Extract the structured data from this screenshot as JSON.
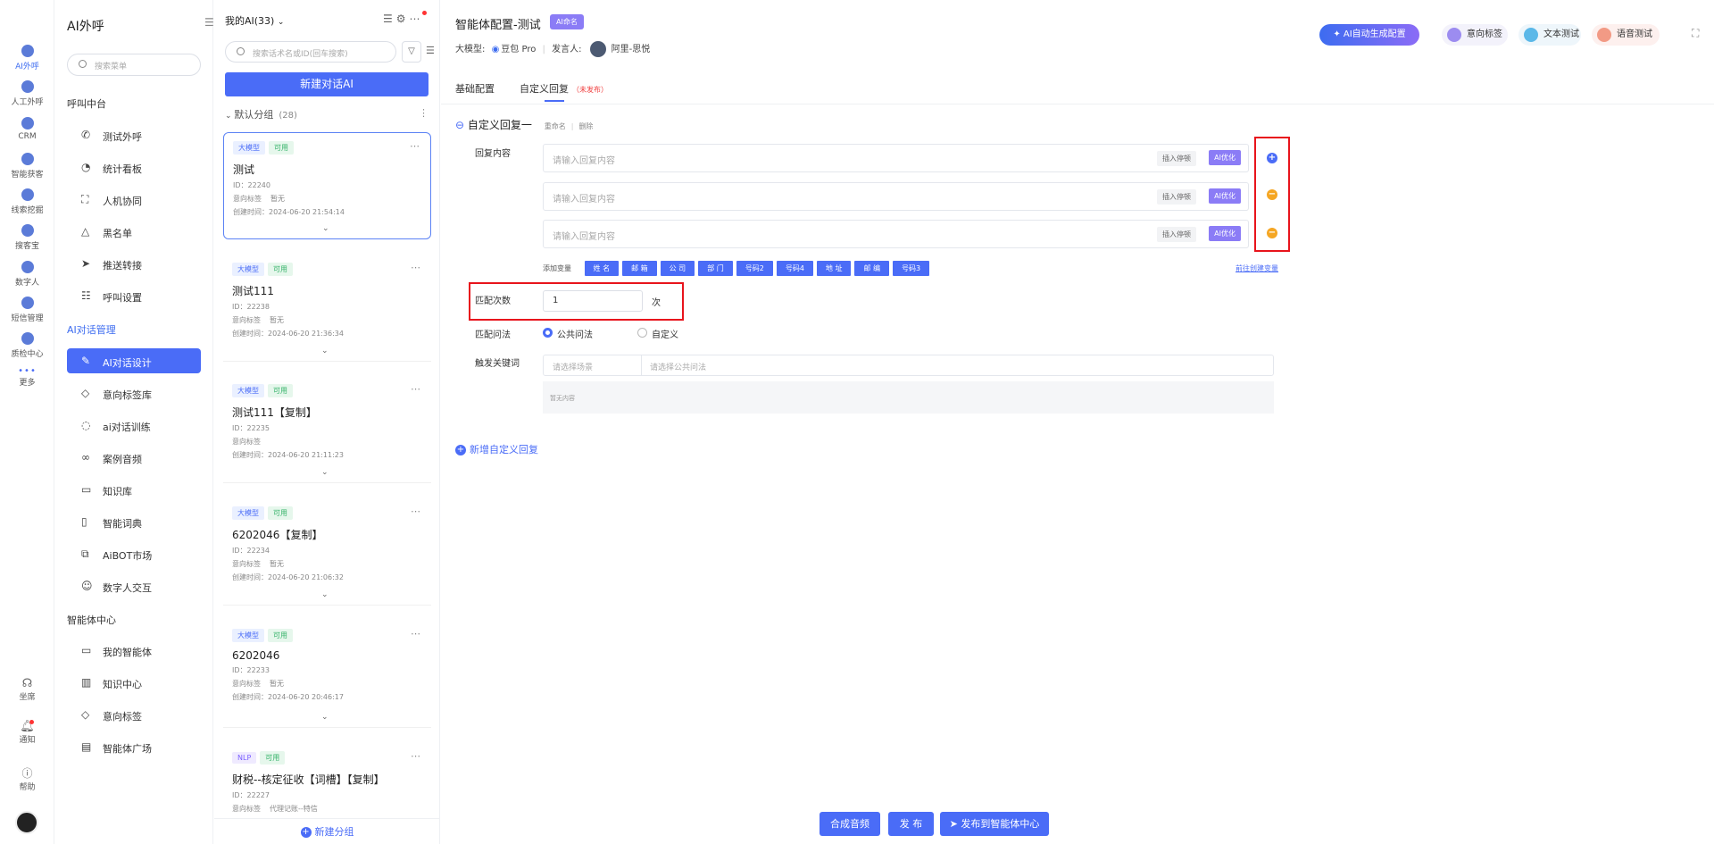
{
  "rail": {
    "items": [
      {
        "label": "AI外呼",
        "icon": "phone-ai-icon"
      },
      {
        "label": "人工外呼",
        "icon": "headset-icon"
      },
      {
        "label": "CRM",
        "icon": "crm-icon"
      },
      {
        "label": "智能获客",
        "icon": "customer-icon"
      },
      {
        "label": "线索挖掘",
        "icon": "clue-icon"
      },
      {
        "label": "搜客宝",
        "icon": "search-customer-icon"
      },
      {
        "label": "数字人",
        "icon": "digital-human-icon"
      },
      {
        "label": "短信管理",
        "icon": "sms-icon"
      },
      {
        "label": "质检中心",
        "icon": "inspection-icon"
      },
      {
        "label": "更多",
        "icon": "more-dots-icon"
      }
    ],
    "bottom": [
      {
        "label": "坐席",
        "icon": "seat-icon"
      },
      {
        "label": "通知",
        "icon": "bell-icon"
      },
      {
        "label": "帮助",
        "icon": "help-icon"
      }
    ]
  },
  "nav": {
    "title": "AI外呼",
    "search_placeholder": "搜索菜单",
    "group1": "呼叫中台",
    "group1_items": [
      "测试外呼",
      "统计看板",
      "人机协同",
      "黑名单",
      "推送转接",
      "呼叫设置"
    ],
    "group2": "AI对话管理",
    "group2_items": [
      "AI对话设计",
      "意向标签库",
      "ai对话训练",
      "案例音频",
      "知识库",
      "智能词典",
      "AiBOT市场",
      "数字人交互"
    ],
    "group3": "智能体中心",
    "group3_items": [
      "我的智能体",
      "知识中心",
      "意向标签",
      "智能体广场"
    ]
  },
  "list": {
    "header": "我的AI(33)",
    "search_placeholder": "搜索话术名或ID(回车搜索)",
    "new_button": "新建对话AI",
    "group_name": "默认分组",
    "group_count": "(28)",
    "footer": "新建分组",
    "cards": [
      {
        "tag1": "大模型",
        "tag2": "可用",
        "name": "测试",
        "id": "ID：22240",
        "intent_label": "意向标签",
        "intent": "暂无",
        "created": "创建时间：2024-06-20 21:54:14"
      },
      {
        "tag1": "大模型",
        "tag2": "可用",
        "name": "测试111",
        "id": "ID：22238",
        "intent_label": "意向标签",
        "intent": "暂无",
        "created": "创建时间：2024-06-20 21:36:34"
      },
      {
        "tag1": "大模型",
        "tag2": "可用",
        "name": "测试111【复制】",
        "id": "ID：22235",
        "intent_label": "意向标签",
        "intent": "",
        "created": "创建时间：2024-06-20 21:11:23"
      },
      {
        "tag1": "大模型",
        "tag2": "可用",
        "name": "6202046【复制】",
        "id": "ID：22234",
        "intent_label": "意向标签",
        "intent": "暂无",
        "created": "创建时间：2024-06-20 21:06:32"
      },
      {
        "tag1": "大模型",
        "tag2": "可用",
        "name": "6202046",
        "id": "ID：22233",
        "intent_label": "意向标签",
        "intent": "暂无",
        "created": "创建时间：2024-06-20 20:46:17"
      },
      {
        "tag1": "NLP",
        "tag2": "可用",
        "name": "财税--核定征收【词槽】【复制】",
        "id": "ID：22227",
        "intent_label": "意向标签",
        "intent": "代理记账--特信",
        "created": ""
      }
    ]
  },
  "main": {
    "title": "智能体配置-测试",
    "name_badge": "AI命名",
    "model_label": "大模型:",
    "model": "豆包 Pro",
    "speaker_label": "发言人:",
    "speaker": "阿里-思悦",
    "ai_gen": "AI自动生成配置",
    "pills": [
      "意向标签",
      "文本测试",
      "语音测试"
    ],
    "tabs": [
      "基础配置",
      "自定义回复"
    ],
    "unpublished": "（未发布）",
    "section_title": "自定义回复一",
    "rename": "重命名",
    "delete": "删除",
    "reply_label": "回复内容",
    "reply_placeholder": "请输入回复内容",
    "insert_pause": "插入停顿",
    "ai_optimize": "AI优化",
    "add_var_label": "添加变量",
    "vars": [
      "姓 名",
      "邮 箱",
      "公 司",
      "部 门",
      "号码2",
      "号码4",
      "地 址",
      "邮 编",
      "号码3"
    ],
    "jump_link": "前往创建变量",
    "match_count_label": "匹配次数",
    "match_count_value": "1",
    "match_count_unit": "次",
    "match_q_label": "匹配问法",
    "radio_public": "公共问法",
    "radio_custom": "自定义",
    "trigger_label": "触发关键词",
    "scene_placeholder": "请选择场景",
    "public_q_placeholder": "请选择公共问法",
    "empty_text": "暂无内容",
    "add_custom": "新增自定义回复",
    "btn_audio": "合成音频",
    "btn_publish": "发 布",
    "btn_publish_center": "发布到智能体中心"
  }
}
